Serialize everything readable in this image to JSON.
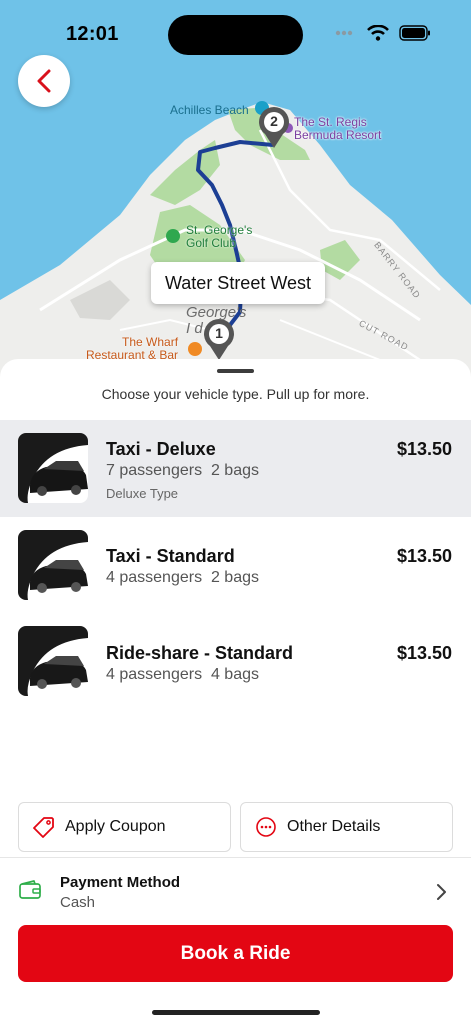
{
  "status_bar": {
    "time": "12:01"
  },
  "map": {
    "labels": {
      "achilles_beach": "Achilles Beach",
      "resort_line1": "The St. Regis",
      "resort_line2": "Bermuda Resort",
      "golf_line1": "St. George's",
      "golf_line2": "Golf Club",
      "barry_road": "BARRY ROAD",
      "cut_road": "CUT ROAD",
      "georges_line1": "George's",
      "georges_line2": "I    d",
      "wharf_line1": "The Wharf",
      "wharf_line2": "Restaurant & Bar"
    },
    "pin_start": "1",
    "pin_end": "2",
    "tooltip": "Water Street West"
  },
  "sheet": {
    "hint": "Choose your vehicle type. Pull up for more.",
    "vehicles": [
      {
        "name": "Taxi - Deluxe",
        "passengers": "7 passengers",
        "bags": "2 bags",
        "type": "Deluxe Type",
        "price": "$13.50",
        "selected": true
      },
      {
        "name": "Taxi - Standard",
        "passengers": "4 passengers",
        "bags": "2 bags",
        "price": "$13.50",
        "selected": false
      },
      {
        "name": "Ride-share - Standard",
        "passengers": "4 passengers",
        "bags": "4 bags",
        "price": "$13.50",
        "selected": false
      }
    ],
    "apply_coupon": "Apply Coupon",
    "other_details": "Other Details",
    "payment": {
      "title": "Payment Method",
      "value": "Cash"
    },
    "book_button": "Book a Ride"
  },
  "colors": {
    "accent": "#e30613",
    "water": "#6fc2e8",
    "route": "#1c3f94",
    "wallet_icon": "#2fae4a"
  },
  "icons": [
    "back-chevron-icon",
    "wifi-icon",
    "battery-icon",
    "cellular-icon",
    "coupon-tag-icon",
    "more-dots-icon",
    "wallet-icon",
    "chevron-right-icon",
    "car-icon"
  ]
}
